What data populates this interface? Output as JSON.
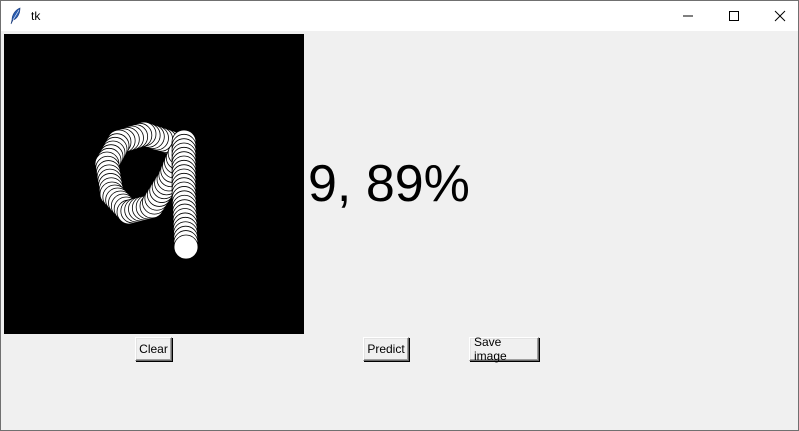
{
  "window": {
    "title": "tk"
  },
  "prediction": {
    "text": "9, 89%"
  },
  "buttons": {
    "clear": "Clear",
    "predict": "Predict",
    "save": "Save image"
  },
  "icons": {
    "app": "feather-icon",
    "minimize": "minimize-icon",
    "maximize": "maximize-icon",
    "close": "close-icon"
  },
  "colors": {
    "canvas_background": "#000000",
    "stroke": "#ffffff",
    "window_background": "#f0f0f0"
  }
}
